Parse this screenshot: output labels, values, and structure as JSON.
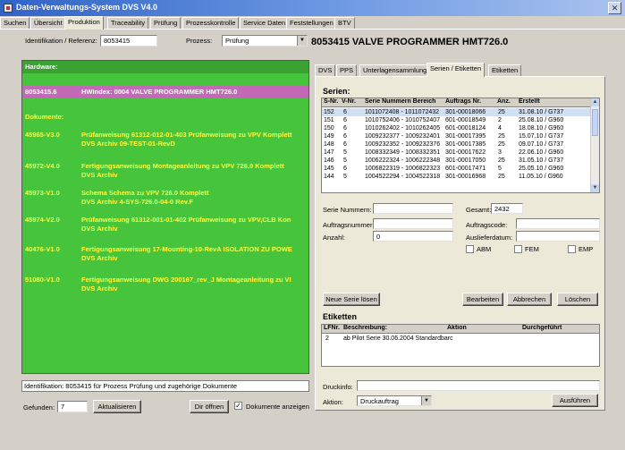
{
  "window": {
    "title": "Daten-Verwaltungs-System DVS V4.0",
    "close_glyph": "✕"
  },
  "menu_tabs": [
    "Suchen",
    "Übersicht",
    "Produktion",
    "Traceability",
    "Prüfung",
    "Prozesskontrolle",
    "Service Daten",
    "Feststellungen",
    "BTV"
  ],
  "active_menu_tab": "Produktion",
  "header": {
    "id_label": "Identifikation / Referenz:",
    "id_value": "8053415",
    "process_label": "Prozess:",
    "process_value": "Prüfung",
    "product_title": "8053415 VALVE PROGRAMMER HMT726.0"
  },
  "tree": {
    "hardware_header": "Hardware:",
    "hardware_item": {
      "code": "8053415.6",
      "desc": "HWIndex: 0004 VALVE PROGRAMMER HMT726.0"
    },
    "documents_header": "Dokumente:",
    "documents": [
      {
        "code": "45965-V3.0",
        "line1": "Prüfanweisung 61312-012-01-403 Prüfanweisung zu VPV Komplett",
        "line2": "DVS Archiv 09-TEST-01-RevD"
      },
      {
        "code": "45972-V4.0",
        "line1": "Fertigungsanweisung Montageanleitung zu VPV 726.0 Komplett",
        "line2": "DVS Archiv"
      },
      {
        "code": "45973-V1.0",
        "line1": "Schema Schema zu VPV 726.0 Komplett",
        "line2": "DVS Archiv 4-SYS-726.0-04-0 Rev.F"
      },
      {
        "code": "45974-V2.0",
        "line1": "Prüfanweisung 61312-001-01-402 Prüfanweisung zu VPV,CLB Kon",
        "line2": "DVS Archiv"
      },
      {
        "code": "40476-V1.0",
        "line1": "Fertigungsanweisung 17-Mounting-10-RevA ISOLATION ZU POWE",
        "line2": "DVS Archiv"
      },
      {
        "code": "51080-V1.0",
        "line1": "Fertigungsanweisung DWG 200167_rev_J Montageanleitung zu VI",
        "line2": "DVS Archiv"
      }
    ]
  },
  "bottom_left": {
    "status_text": "Identifikation: 8053415 für Prozess Prüfung und zugehörige Dokumente",
    "found_label": "Gefunden:",
    "found_value": "7",
    "refresh_button": "Aktualisieren",
    "open_dir_button": "Dir öffnen",
    "show_docs_label": "Dokumente anzeigen",
    "show_docs_checked": "✓"
  },
  "right_tabs": [
    "DVS",
    "PPS",
    "Unterlagensammlung",
    "Serien / Etiketten",
    "Etiketten"
  ],
  "active_right_tab": "Serien / Etiketten",
  "series": {
    "header": "Serien:",
    "columns": [
      "S-Nr.",
      "V-Nr.",
      "Serie Nummern Bereich",
      "Auftrags Nr.",
      "Anz.",
      "Erstellt"
    ],
    "rows": [
      [
        "152",
        "6",
        "1011072408 - 1011072432",
        "301-00018066",
        "25",
        "31.08.10 / G737"
      ],
      [
        "151",
        "6",
        "1010752406 - 1010752407",
        "601-00018549",
        "2",
        "25.08.10 / G960"
      ],
      [
        "150",
        "6",
        "1010262402 - 1010262405",
        "601-00018124",
        "4",
        "18.08.10 / G960"
      ],
      [
        "149",
        "6",
        "1009232377 - 1009232401",
        "301-00017395",
        "25",
        "15.07.10 / G737"
      ],
      [
        "148",
        "6",
        "1009232352 - 1009232376",
        "301-00017385",
        "25",
        "09.07.10 / G737"
      ],
      [
        "147",
        "5",
        "1008332349 - 1008332351",
        "301-00017622",
        "3",
        "22.06.10 / G960"
      ],
      [
        "146",
        "5",
        "1006222324 - 1006222348",
        "301-00017050",
        "25",
        "31.05.10 / G737"
      ],
      [
        "145",
        "6",
        "1006822319 - 1006822323",
        "601-00017471",
        "5",
        "25.05.10 / G960"
      ],
      [
        "144",
        "5",
        "1004522294 - 1004522318",
        "301-00016968",
        "25",
        "11.05.10 / G960"
      ]
    ],
    "serial_numbers_label": "Serie Nummern:",
    "total_label": "Gesamt:",
    "total_value": "2432",
    "order_label": "Auftragsnummer:",
    "order_code_label": "Auftragscode:",
    "count_label": "Anzahl:",
    "count_value": "0",
    "delivery_label": "Auslieferdatum:",
    "chk_abm": "ABM",
    "chk_fem": "FEM",
    "chk_emp": "EMP",
    "btn_new": "Neue Serie lösen",
    "btn_edit": "Bearbeiten",
    "btn_cancel": "Abbrechen",
    "btn_delete": "Löschen"
  },
  "labels": {
    "header": "Etiketten",
    "columns": [
      "LFNr.",
      "Beschreibung:",
      "Aktion",
      "Durchgeführt"
    ],
    "rows": [
      [
        "2",
        "ab Pilot Serie 30.06.2004 Standardbarc",
        "",
        ""
      ]
    ]
  },
  "print": {
    "info_label": "Druckinfo:",
    "action_label": "Aktion:",
    "action_value": "Druckauftrag",
    "execute_button": "Ausführen"
  },
  "icons": {
    "dropdown": "▼",
    "scroll_up": "▲",
    "scroll_down": "▼"
  }
}
